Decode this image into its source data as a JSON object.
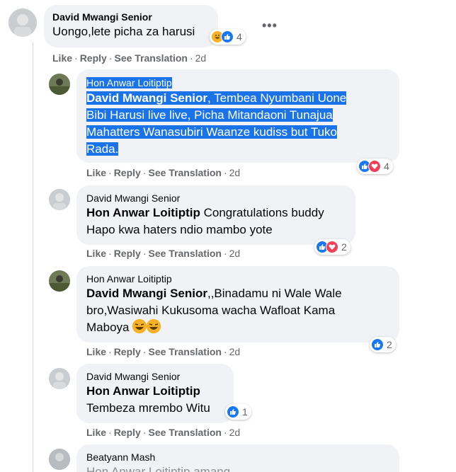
{
  "colors": {
    "bubble": "#f0f2f5",
    "link": "#65676b",
    "like": "#1877f2",
    "love": "#f33e58",
    "selection": "#1a73e8"
  },
  "action_labels": {
    "like": "Like",
    "reply": "Reply",
    "translate": "See Translation",
    "dot": "·"
  },
  "comments": [
    {
      "author": "David Mwangi Senior",
      "text": "Uongo,lete picha za harusi",
      "time": "2d",
      "reactions": {
        "icons": [
          "haha-icon",
          "like-icon"
        ],
        "count": "4"
      },
      "menu": "•••"
    },
    {
      "author": "Hon Anwar Loitiptip",
      "mention": "David Mwangi Senior",
      "text": ", Tembea Nyumbani Uone Bibi Harusi live live, Picha Mitandaoni Tunajua Mahatters Wanasubiri Waanze kudiss but Tuko Rada.",
      "line1": ", Tembea Nyumbani Uone",
      "line2": "Bibi Harusi live live, Picha Mitandaoni Tunajua",
      "line3": "Mahatters Wanasubiri Waanze kudiss but Tuko",
      "line4": "Rada.",
      "time": "2d",
      "reactions": {
        "icons": [
          "like-icon",
          "love-icon"
        ],
        "count": "4"
      }
    },
    {
      "author": "David Mwangi Senior",
      "mention": "Hon Anwar Loitiptip",
      "line1": " Congratulations buddy",
      "line2": "Hapo kwa haters ndio mambo yote",
      "time": "2d",
      "reactions": {
        "icons": [
          "like-icon",
          "love-icon"
        ],
        "count": "2"
      }
    },
    {
      "author": "Hon Anwar Loitiptip",
      "mention": "David Mwangi Senior",
      "line1": ",,Binadamu ni Wale Wale",
      "line2": "bro,Wasiwahi Kukusoma wacha Wafloat Kama",
      "line3": "Maboya",
      "time": "2d",
      "reactions": {
        "icons": [
          "like-icon"
        ],
        "count": "2"
      }
    },
    {
      "author": "David Mwangi Senior",
      "mention": "Hon Anwar Loitiptip",
      "line2": "Tembeza mrembo Witu",
      "time": "2d",
      "reactions": {
        "icons": [
          "like-icon"
        ],
        "count": "1"
      }
    },
    {
      "author": "Beatyann Mash",
      "line1": "Hon Anwar Loitiptip amang..."
    }
  ]
}
